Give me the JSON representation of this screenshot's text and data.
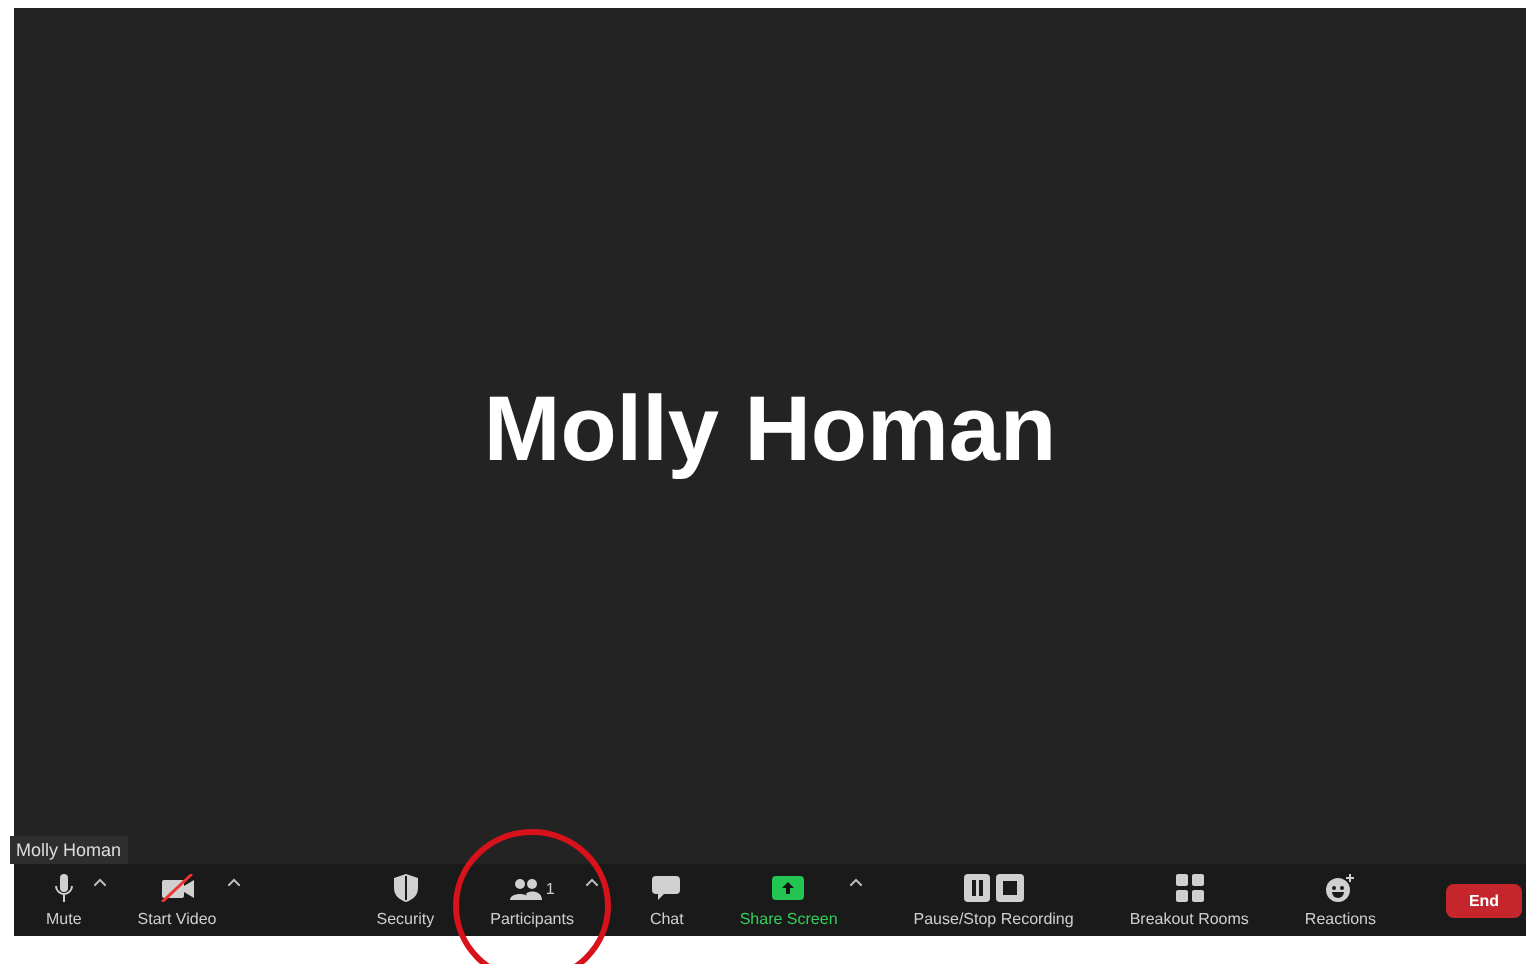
{
  "meeting": {
    "speaker_name": "Molly Homan",
    "name_tag": "Molly Homan"
  },
  "toolbar": {
    "left": [
      {
        "kind": "mic",
        "label": "Mute",
        "has_menu": true,
        "off": false
      },
      {
        "kind": "video",
        "label": "Start Video",
        "has_menu": true,
        "off": true
      }
    ],
    "center": [
      {
        "kind": "security",
        "label": "Security",
        "has_menu": false
      },
      {
        "kind": "participants",
        "label": "Participants",
        "count": "1",
        "has_menu": true
      },
      {
        "kind": "chat",
        "label": "Chat",
        "has_menu": false
      },
      {
        "kind": "share",
        "label": "Share Screen",
        "has_menu": true
      },
      {
        "kind": "record",
        "label": "Pause/Stop Recording",
        "has_menu": false
      },
      {
        "kind": "breakout",
        "label": "Breakout Rooms",
        "has_menu": false
      },
      {
        "kind": "reactions",
        "label": "Reactions",
        "has_menu": false
      }
    ],
    "end_button": "End"
  },
  "annotations": [
    {
      "kind": "circle"
    }
  ]
}
